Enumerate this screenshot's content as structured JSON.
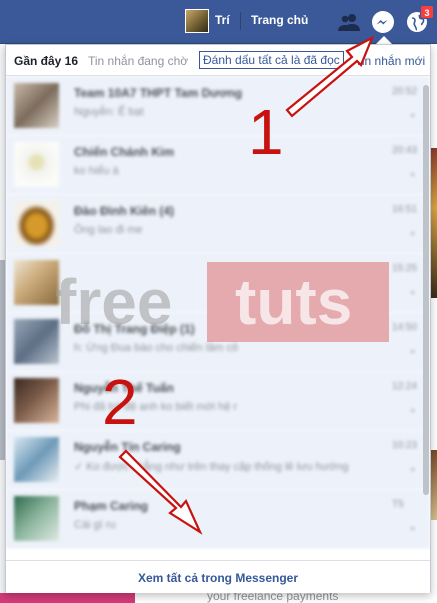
{
  "topbar": {
    "username": "Trí",
    "home_label": "Trang chủ",
    "notification_count": "3",
    "brand_color": "#3b5998"
  },
  "panel": {
    "tab_recent": "Gần đây 16",
    "tab_pending": "Tin nhắn đang chờ",
    "mark_all_read": "Đánh dấu tất cả là đã đọc",
    "new_message": "Tin nhắn mới",
    "footer_link": "Xem tất cả trong Messenger"
  },
  "conversations": [
    {
      "name": "Team 10A7 THPT Tam Dương",
      "preview": "Nguyễn: Ế bạt",
      "time": "20:52"
    },
    {
      "name": "Chiến Chánh Kim",
      "preview": "ko hiểu à",
      "time": "20:43"
    },
    {
      "name": "Đào Đình Kiên (4)",
      "preview": "Ông lao đi me",
      "time": "16:51"
    },
    {
      "name": "",
      "preview": "",
      "time": "15:25"
    },
    {
      "name": "Đỗ Thị Trang Điệp (1)",
      "preview": "h: Ừng Đua bào cho chiến lâm cô",
      "time": "14:50"
    },
    {
      "name": "Nguyễn Thế Tuấn",
      "preview": "Phi đã trò đệ anh ko biết mới hệ r",
      "time": "12:24"
    },
    {
      "name": "Nguyễn Tín Caring",
      "preview": "✓ Ko được chẳng như trên thay cặp thống lê lưu hướng",
      "time": "10:23"
    },
    {
      "name": "Phạm Caring",
      "preview": "Cái gì ru",
      "time": "T5"
    }
  ],
  "watermark": {
    "left": "free",
    "right": "tuts"
  },
  "annotations": {
    "step1": "1",
    "step2": "2"
  },
  "background_page": {
    "bottom_text": "your freelance payments"
  }
}
